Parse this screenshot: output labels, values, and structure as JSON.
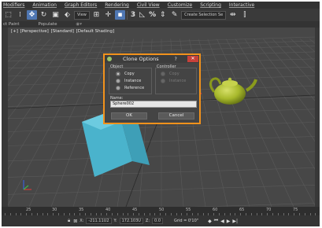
{
  "menubar": {
    "items": [
      "Modifiers",
      "Animation",
      "Graph Editors",
      "Rendering",
      "Civil View",
      "Customize",
      "Scripting",
      "Interactive"
    ]
  },
  "toolbar": {
    "view_dropdown": "View",
    "snap_label": "3",
    "percent_label": "%",
    "selection_set_dropdown": "Create Selection Se"
  },
  "ribbon": {
    "object_paint": "ct Paint",
    "populate": "Populate"
  },
  "viewport": {
    "label_parts": [
      "[+]",
      "[Perspective]",
      "[Standard]",
      "[Default Shading]"
    ],
    "colors": {
      "background": "#474747",
      "grid": "#5a5a5a",
      "box": "#4ab3cc",
      "teapot": "#a8b92c"
    }
  },
  "dialog": {
    "title": "Clone Options",
    "help": "?",
    "close": "✕",
    "object_group": {
      "title": "Object",
      "options": [
        "Copy",
        "Instance",
        "Reference"
      ],
      "selected": "Copy"
    },
    "controller_group": {
      "title": "Controller",
      "options": [
        "Copy",
        "Instance"
      ],
      "enabled": false
    },
    "name_label": "Name:",
    "name_value": "Sphere002",
    "ok_label": "OK",
    "cancel_label": "Cancel",
    "accent_color": "#f2921c"
  },
  "timeline": {
    "ticks": [
      "25",
      "30",
      "35",
      "40",
      "45",
      "50",
      "55",
      "60",
      "65",
      "70",
      "75"
    ]
  },
  "statusbar": {
    "x_label": "X:",
    "x_value": "-211.11U2",
    "y_label": "Y:",
    "y_value": "172.103U",
    "z_label": "Z:",
    "z_value": "0.0",
    "grid_label": "Grid = 0'10\""
  }
}
